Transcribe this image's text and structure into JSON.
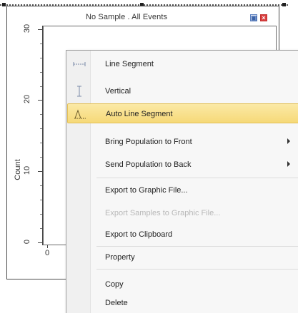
{
  "plot": {
    "title": "No Sample . All Events",
    "y_axis_title": "Count",
    "y_tick_labels": [
      "30",
      "20",
      "10",
      "0"
    ],
    "x_tick_labels": [
      "0"
    ]
  },
  "window_buttons": {
    "restore_icon": "restore-icon",
    "close_icon": "close-icon"
  },
  "context_menu": {
    "items": [
      {
        "label": "Line Segment",
        "icon": "line-segment-icon"
      },
      {
        "label": "Vertical",
        "icon": "vertical-icon"
      },
      {
        "label": "Auto Line Segment",
        "icon": "auto-line-segment-icon",
        "highlighted": true
      },
      {
        "label": "Bring Population to Front",
        "submenu": true
      },
      {
        "label": "Send Population to Back",
        "submenu": true
      },
      {
        "label": "Export to Graphic File..."
      },
      {
        "label": "Export Samples to Graphic File...",
        "disabled": true
      },
      {
        "label": "Export to Clipboard"
      },
      {
        "label": "Property"
      },
      {
        "label": "Copy"
      },
      {
        "label": "Delete"
      }
    ]
  },
  "colors": {
    "highlight": "#f6d978",
    "highlight_border": "#e2bf55",
    "close_button": "#d94040",
    "restore_button": "#3a62a8",
    "disabled_text": "#b8b8b8"
  }
}
